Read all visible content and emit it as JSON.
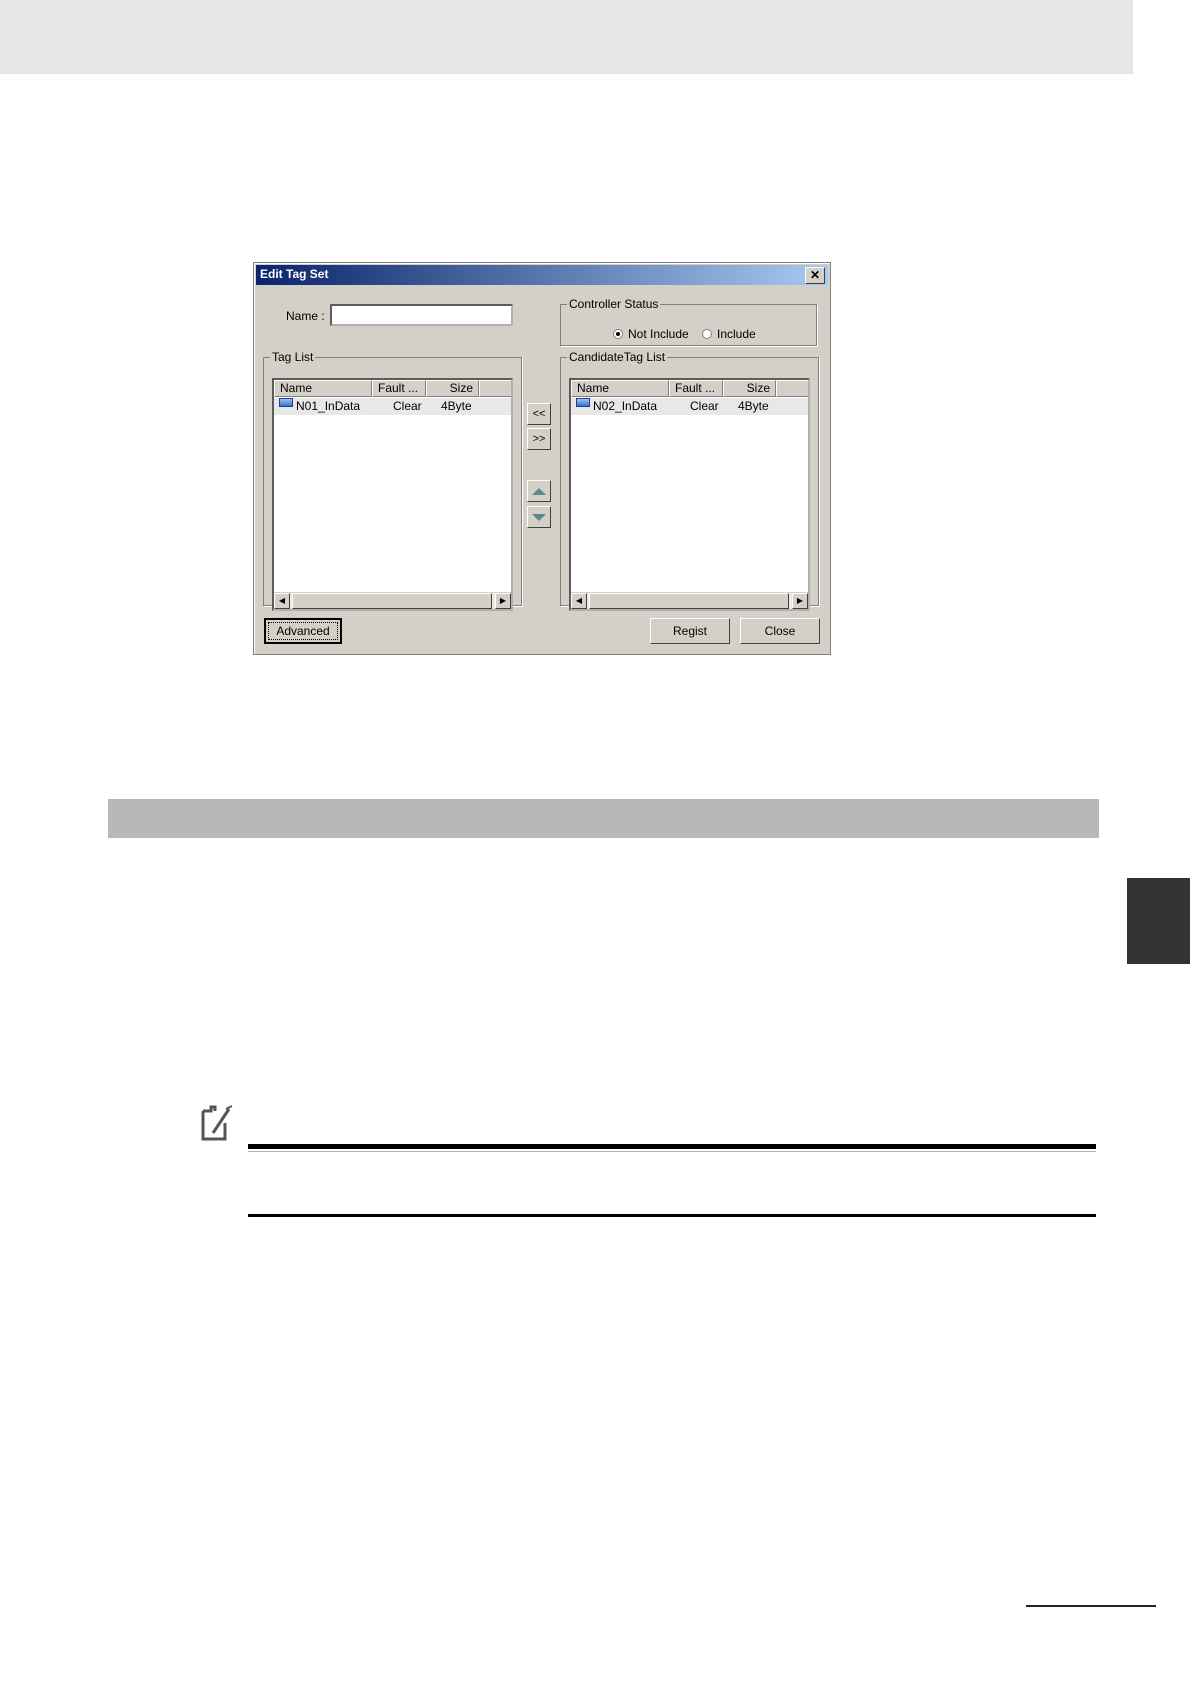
{
  "dialog": {
    "title": "Edit Tag Set",
    "close_glyph": "✕",
    "name_label": "Name :",
    "name_value": "",
    "controller_status": {
      "legend": "Controller Status",
      "options": [
        {
          "label": "Not Include",
          "selected": true
        },
        {
          "label": "Include",
          "selected": false
        }
      ]
    },
    "tag_list": {
      "legend": "Tag List",
      "columns": [
        "Name",
        "Fault ...",
        "Size",
        "B"
      ],
      "rows": [
        {
          "icon": "tag-icon",
          "name": "N01_InData",
          "fault": "Clear",
          "size": "4Byte"
        }
      ]
    },
    "candidate_list": {
      "legend": "CandidateTag List",
      "columns": [
        "Name",
        "Fault ...",
        "Size",
        "B"
      ],
      "rows": [
        {
          "icon": "tag-icon",
          "name": "N02_InData",
          "fault": "Clear",
          "size": "4Byte"
        }
      ]
    },
    "move_buttons": {
      "left": "<<",
      "right": ">>"
    },
    "order_buttons": {
      "up_icon": "arrow-up-icon",
      "down_icon": "arrow-down-icon"
    },
    "buttons": {
      "advanced": "Advanced",
      "regist": "Regist",
      "close": "Close"
    },
    "title_gradient": [
      "#0a246a",
      "#a6caf0"
    ]
  },
  "page": {
    "note_icon": "precautions-icon",
    "section_bar_color": "#b8b8b8",
    "side_tab_color": "#333333"
  }
}
